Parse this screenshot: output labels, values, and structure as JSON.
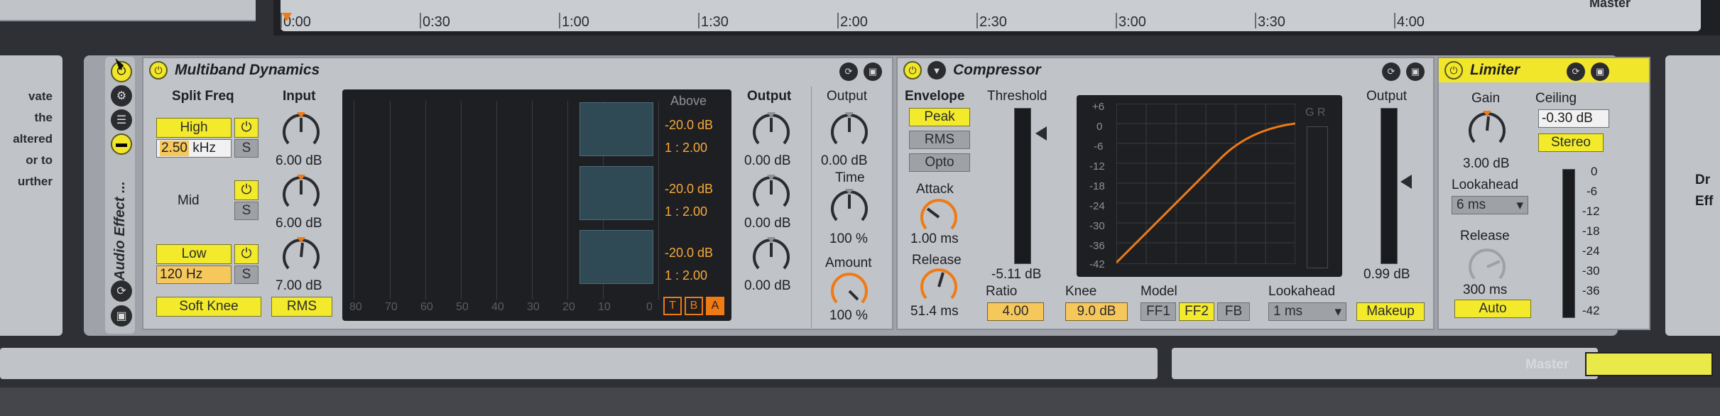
{
  "timeline": {
    "ticks": [
      "0:00",
      "0:30",
      "1:00",
      "1:30",
      "2:00",
      "2:30",
      "3:00",
      "3:30",
      "4:00"
    ],
    "top_right": "Master"
  },
  "left_panel_text": [
    "vate",
    "the",
    "altered",
    "or to",
    "urther"
  ],
  "rack": {
    "label": "Audio Effect ..."
  },
  "multiband": {
    "title": "Multiband Dynamics",
    "split_freq": "Split Freq",
    "input": "Input",
    "high": "High",
    "high_freq": "2.50",
    "high_unit": "kHz",
    "mid": "Mid",
    "low": "Low",
    "low_freq": "120 Hz",
    "s": "S",
    "input_high": "6.00 dB",
    "input_mid": "6.00 dB",
    "input_low": "7.00 dB",
    "soft_knee": "Soft Knee",
    "rms": "RMS",
    "above": "Above",
    "thresholds": [
      "-20.0 dB",
      "-20.0 dB",
      "-20.0 dB"
    ],
    "ratios": [
      "1 : 2.00",
      "1 : 2.00",
      "1 : 2.00"
    ],
    "scale": [
      "80",
      "70",
      "60",
      "50",
      "40",
      "30",
      "20",
      "10",
      "0"
    ],
    "tba": [
      "T",
      "B",
      "A"
    ],
    "output": "Output",
    "outputs": [
      "0.00 dB",
      "0.00 dB",
      "0.00 dB"
    ],
    "out2_label": "Output",
    "out2_value": "0.00 dB",
    "time_label": "Time",
    "time_value": "100 %",
    "amount_label": "Amount",
    "amount_value": "100 %"
  },
  "compressor": {
    "title": "Compressor",
    "envelope": "Envelope",
    "peak": "Peak",
    "rms": "RMS",
    "opto": "Opto",
    "attack_label": "Attack",
    "attack_value": "1.00 ms",
    "release_label": "Release",
    "release_value": "51.4 ms",
    "threshold_label": "Threshold",
    "threshold_value": "-5.11 dB",
    "graph_scale": [
      "+6",
      "0",
      "-6",
      "-12",
      "-18",
      "-24",
      "-30",
      "-36",
      "-42"
    ],
    "gr": "G R",
    "output_label": "Output",
    "output_value": "0.99 dB",
    "ratio_label": "Ratio",
    "ratio_value": "4.00",
    "knee_label": "Knee",
    "knee_value": "9.0 dB",
    "model_label": "Model",
    "ff1": "FF1",
    "ff2": "FF2",
    "fb": "FB",
    "lookahead_label": "Lookahead",
    "lookahead_value": "1 ms",
    "makeup": "Makeup"
  },
  "limiter": {
    "title": "Limiter",
    "gain_label": "Gain",
    "gain_value": "3.00 dB",
    "ceiling_label": "Ceiling",
    "ceiling_value": "-0.30 dB",
    "stereo": "Stereo",
    "lookahead_label": "Lookahead",
    "lookahead_value": "6 ms",
    "release_label": "Release",
    "release_value": "300 ms",
    "auto": "Auto",
    "scale": [
      "0",
      "-6",
      "-12",
      "-18",
      "-24",
      "-30",
      "-36",
      "-42"
    ]
  },
  "right_panel_text": [
    "Dr",
    "Eff"
  ],
  "bottom": {
    "master": "Master"
  },
  "colors": {
    "accent_yellow": "#f2ea2a",
    "accent_orange": "#f07a14",
    "panel": "#c0c3c8"
  }
}
